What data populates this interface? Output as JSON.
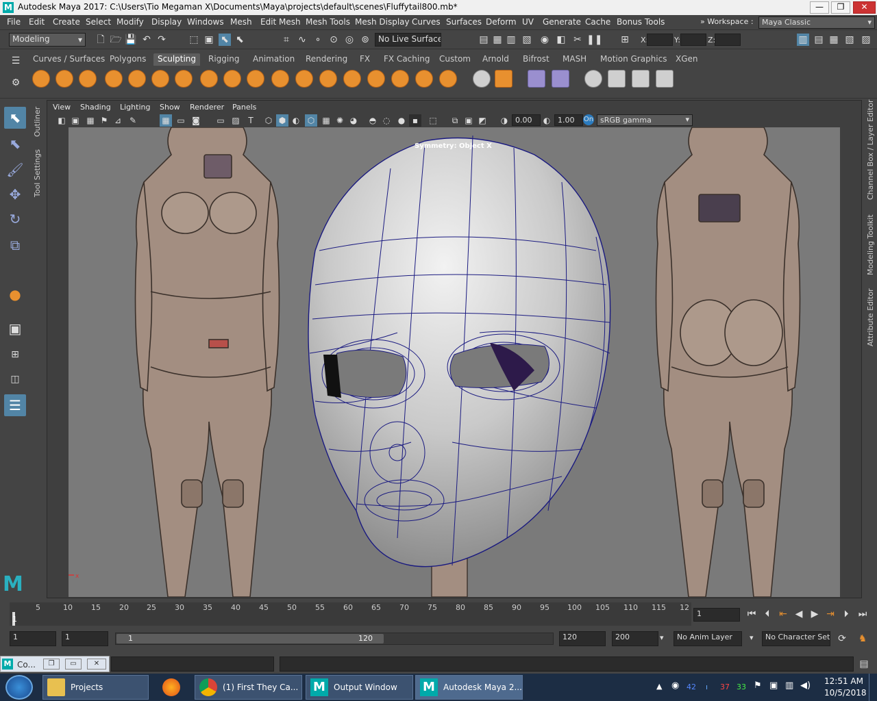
{
  "window": {
    "title": "Autodesk Maya 2017: C:\\Users\\Tio Megaman X\\Documents\\Maya\\projects\\default\\scenes\\Fluffytail800.mb*",
    "app_icon": "M",
    "min": "—",
    "max": "❐",
    "close": "✕"
  },
  "menubar": {
    "items": [
      "File",
      "Edit",
      "Create",
      "Select",
      "Modify",
      "Display",
      "Windows",
      "Mesh",
      "Edit Mesh",
      "Mesh Tools",
      "Mesh Display",
      "Curves",
      "Surfaces",
      "Deform",
      "UV",
      "Generate",
      "Cache",
      "Bonus Tools"
    ],
    "workspace_label": "Workspace :",
    "workspace_value": "Maya Classic"
  },
  "statusline": {
    "menuset": "Modeling",
    "live_surface": "No Live Surface",
    "x_label": "X:",
    "y_label": "Y:",
    "z_label": "Z:"
  },
  "shelf": {
    "tabs": [
      "Curves / Surfaces",
      "Polygons",
      "Sculpting",
      "Rigging",
      "Animation",
      "Rendering",
      "FX",
      "FX Caching",
      "Custom",
      "Arnold",
      "Bifrost",
      "MASH",
      "Motion Graphics",
      "XGen"
    ],
    "active_tab": "Sculpting"
  },
  "side_tabs": {
    "outliner": "Outliner",
    "tool_settings": "Tool Settings",
    "channel_box": "Channel Box / Layer Editor",
    "modeling_toolkit": "Modeling Toolkit",
    "attribute_editor": "Attribute Editor"
  },
  "panel": {
    "menus": [
      "View",
      "Shading",
      "Lighting",
      "Show",
      "Renderer",
      "Panels"
    ],
    "exposure": "0.00",
    "gamma": "1.00",
    "colorspace": "sRGB gamma",
    "hud_symmetry": "Symmetry: Object X",
    "axis_x": "x",
    "axis_y": "y"
  },
  "timeline": {
    "ticks": [
      "5",
      "10",
      "15",
      "20",
      "25",
      "30",
      "35",
      "40",
      "45",
      "50",
      "55",
      "60",
      "65",
      "70",
      "75",
      "80",
      "85",
      "90",
      "95",
      "100",
      "105",
      "110",
      "115",
      "12"
    ],
    "current_frame_marker": "1",
    "current_frame": "1"
  },
  "range": {
    "start": "1",
    "playback_start": "1",
    "slider_start": "1",
    "slider_end": "120",
    "playback_end": "120",
    "end": "200",
    "anim_layer": "No Anim Layer",
    "char_set": "No Character Set"
  },
  "cmdline": {
    "tab_label": "Co..."
  },
  "taskbar": {
    "items": [
      {
        "label": "Projects",
        "icon": "folder-icon"
      },
      {
        "label": "",
        "icon": "firefox-icon"
      },
      {
        "label": "(1) First They Ca...",
        "icon": "chrome-icon"
      },
      {
        "label": "Output Window",
        "icon": "maya-icon"
      },
      {
        "label": "Autodesk Maya 2...",
        "icon": "maya-icon"
      }
    ],
    "tray_nums": [
      "42",
      "37",
      "33"
    ],
    "time": "12:51 AM",
    "date": "10/5/2018"
  },
  "colors": {
    "maya_bg": "#444444",
    "accent_blue": "#5285a6",
    "shelf_orange": "#e8902f",
    "viewport_bg": "#7a7a7a",
    "wireframe": "#1a1a80"
  }
}
